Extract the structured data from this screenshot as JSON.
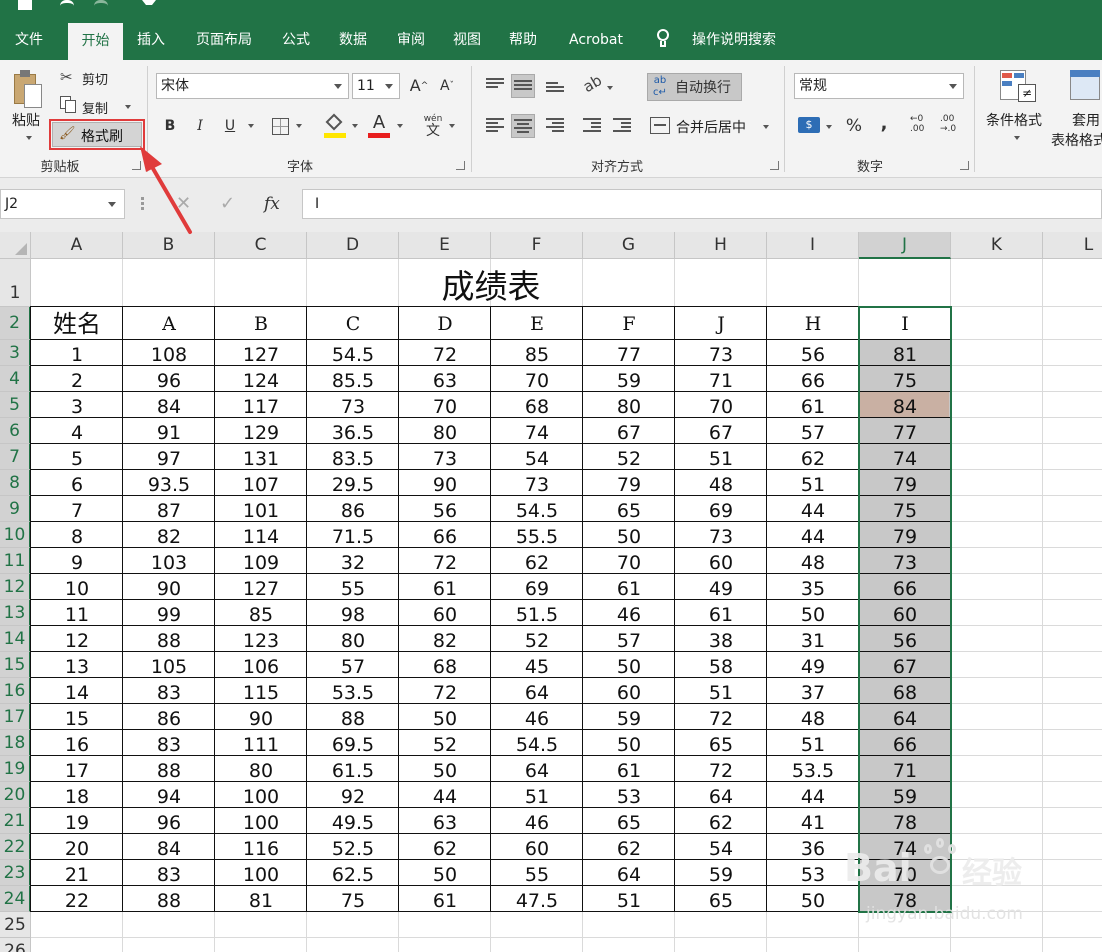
{
  "tabs": [
    "文件",
    "开始",
    "插入",
    "页面布局",
    "公式",
    "数据",
    "审阅",
    "视图",
    "帮助",
    "Acrobat",
    "操作说明搜索"
  ],
  "clipboard": {
    "paste": "粘贴",
    "cut": "剪切",
    "copy": "复制",
    "format_painter": "格式刷",
    "group": "剪贴板"
  },
  "font": {
    "name": "宋体",
    "size": "11",
    "bold": "B",
    "italic": "I",
    "underline": "U",
    "font_color": "A",
    "phonetic": "wén",
    "group": "字体"
  },
  "alignment": {
    "wrap": "自动换行",
    "merge": "合并后居中",
    "group": "对齐方式"
  },
  "number": {
    "format": "常规",
    "percent": "%",
    "comma": ",",
    "group": "数字"
  },
  "styles": {
    "conditional": "条件格式",
    "table_line1": "套用",
    "table_line2": "表格格式"
  },
  "formula_bar": {
    "cell_ref": "J2",
    "fx": "fx",
    "cancel": "✕",
    "enter": "✓",
    "content": "I"
  },
  "columns": [
    "A",
    "B",
    "C",
    "D",
    "E",
    "F",
    "G",
    "H",
    "I",
    "J",
    "K",
    "L"
  ],
  "rows": [
    "1",
    "2",
    "3",
    "4",
    "5",
    "6",
    "7",
    "8",
    "9",
    "10",
    "11",
    "12",
    "13",
    "14",
    "15",
    "16",
    "17",
    "18",
    "19",
    "20",
    "21",
    "22",
    "23",
    "24",
    "25",
    "26"
  ],
  "sheet": {
    "title": "成绩表",
    "header": [
      "姓名",
      "A",
      "B",
      "C",
      "D",
      "E",
      "F",
      "J",
      "H",
      "I"
    ],
    "data": [
      [
        "1",
        "108",
        "127",
        "54.5",
        "72",
        "85",
        "77",
        "73",
        "56",
        "81"
      ],
      [
        "2",
        "96",
        "124",
        "85.5",
        "63",
        "70",
        "59",
        "71",
        "66",
        "75"
      ],
      [
        "3",
        "84",
        "117",
        "73",
        "70",
        "68",
        "80",
        "70",
        "61",
        "84"
      ],
      [
        "4",
        "91",
        "129",
        "36.5",
        "80",
        "74",
        "67",
        "67",
        "57",
        "77"
      ],
      [
        "5",
        "97",
        "131",
        "83.5",
        "73",
        "54",
        "52",
        "51",
        "62",
        "74"
      ],
      [
        "6",
        "93.5",
        "107",
        "29.5",
        "90",
        "73",
        "79",
        "48",
        "51",
        "79"
      ],
      [
        "7",
        "87",
        "101",
        "86",
        "56",
        "54.5",
        "65",
        "69",
        "44",
        "75"
      ],
      [
        "8",
        "82",
        "114",
        "71.5",
        "66",
        "55.5",
        "50",
        "73",
        "44",
        "79"
      ],
      [
        "9",
        "103",
        "109",
        "32",
        "72",
        "62",
        "70",
        "60",
        "48",
        "73"
      ],
      [
        "10",
        "90",
        "127",
        "55",
        "61",
        "69",
        "61",
        "49",
        "35",
        "66"
      ],
      [
        "11",
        "99",
        "85",
        "98",
        "60",
        "51.5",
        "46",
        "61",
        "50",
        "60"
      ],
      [
        "12",
        "88",
        "123",
        "80",
        "82",
        "52",
        "57",
        "38",
        "31",
        "56"
      ],
      [
        "13",
        "105",
        "106",
        "57",
        "68",
        "45",
        "50",
        "58",
        "49",
        "67"
      ],
      [
        "14",
        "83",
        "115",
        "53.5",
        "72",
        "64",
        "60",
        "51",
        "37",
        "68"
      ],
      [
        "15",
        "86",
        "90",
        "88",
        "50",
        "46",
        "59",
        "72",
        "48",
        "64"
      ],
      [
        "16",
        "83",
        "111",
        "69.5",
        "52",
        "54.5",
        "50",
        "65",
        "51",
        "66"
      ],
      [
        "17",
        "88",
        "80",
        "61.5",
        "50",
        "64",
        "61",
        "72",
        "53.5",
        "71"
      ],
      [
        "18",
        "94",
        "100",
        "92",
        "44",
        "51",
        "53",
        "64",
        "44",
        "59"
      ],
      [
        "19",
        "96",
        "100",
        "49.5",
        "63",
        "46",
        "65",
        "62",
        "41",
        "78"
      ],
      [
        "20",
        "84",
        "116",
        "52.5",
        "62",
        "60",
        "62",
        "54",
        "36",
        "74"
      ],
      [
        "21",
        "83",
        "100",
        "62.5",
        "50",
        "55",
        "64",
        "59",
        "53",
        "70"
      ],
      [
        "22",
        "88",
        "81",
        "75",
        "61",
        "47.5",
        "51",
        "65",
        "50",
        "78"
      ]
    ]
  },
  "watermark": {
    "brand_left": "Bai",
    "brand_right": "经验",
    "url": "jingyan.baidu.com"
  },
  "colors": {
    "excel_green": "#217346",
    "selection_fill": "#c8c8c8",
    "highlight_fill": "#c9b0a3",
    "callout_red": "#e03b3b"
  }
}
